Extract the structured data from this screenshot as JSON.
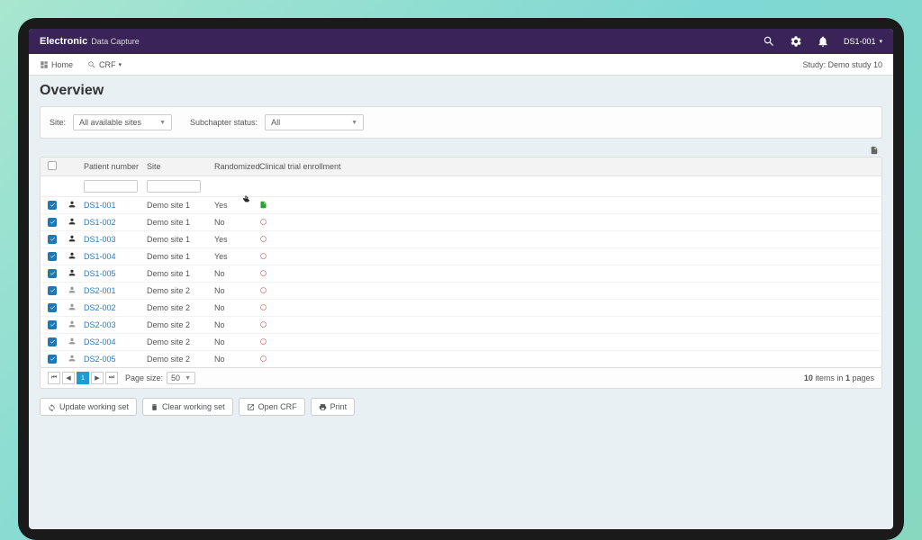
{
  "brand": {
    "bold": "Electronic",
    "light": "Data Capture"
  },
  "user": {
    "label": "DS1-001"
  },
  "nav": {
    "home": "Home",
    "crf": "CRF"
  },
  "study_label": "Study: Demo study 10",
  "page_title": "Overview",
  "filters": {
    "site_label": "Site:",
    "site_value": "All available sites",
    "status_label": "Subchapter status:",
    "status_value": "All"
  },
  "columns": {
    "patient_number": "Patient number",
    "site": "Site",
    "randomized": "Randomized",
    "enrollment": "Clinical trial enrollment"
  },
  "rows": [
    {
      "pn": "DS1-001",
      "site": "Demo site 1",
      "rand": "Yes",
      "enroll": "complete",
      "icon": "dark"
    },
    {
      "pn": "DS1-002",
      "site": "Demo site 1",
      "rand": "No",
      "enroll": "pending",
      "icon": "dark"
    },
    {
      "pn": "DS1-003",
      "site": "Demo site 1",
      "rand": "Yes",
      "enroll": "pending",
      "icon": "dark"
    },
    {
      "pn": "DS1-004",
      "site": "Demo site 1",
      "rand": "Yes",
      "enroll": "pending",
      "icon": "dark"
    },
    {
      "pn": "DS1-005",
      "site": "Demo site 1",
      "rand": "No",
      "enroll": "pending",
      "icon": "dark"
    },
    {
      "pn": "DS2-001",
      "site": "Demo site 2",
      "rand": "No",
      "enroll": "pending",
      "icon": "light"
    },
    {
      "pn": "DS2-002",
      "site": "Demo site 2",
      "rand": "No",
      "enroll": "pending",
      "icon": "light"
    },
    {
      "pn": "DS2-003",
      "site": "Demo site 2",
      "rand": "No",
      "enroll": "pending",
      "icon": "light"
    },
    {
      "pn": "DS2-004",
      "site": "Demo site 2",
      "rand": "No",
      "enroll": "pending",
      "icon": "light"
    },
    {
      "pn": "DS2-005",
      "site": "Demo site 2",
      "rand": "No",
      "enroll": "pending",
      "icon": "light"
    }
  ],
  "pager": {
    "page_size_label": "Page size:",
    "page_size_value": "50",
    "current_page": "1",
    "total_items": "10",
    "total_pages": "1",
    "info_items_in": "items in",
    "info_pages": "pages"
  },
  "actions": {
    "update": "Update working set",
    "clear": "Clear working set",
    "open": "Open CRF",
    "print": "Print"
  }
}
